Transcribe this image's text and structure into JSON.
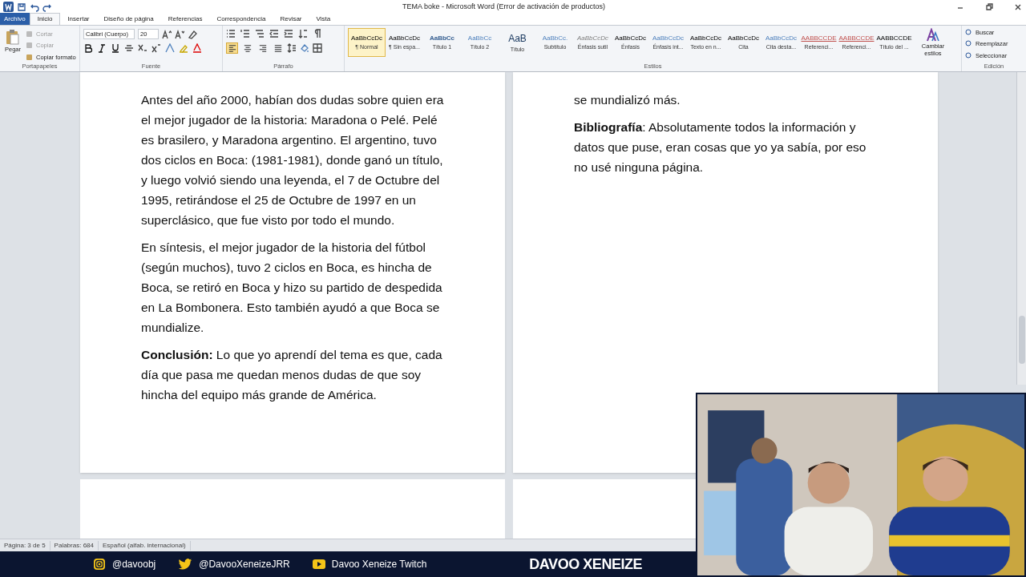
{
  "window": {
    "title": "TEMA boke  -  Microsoft Word (Error de activación de productos)"
  },
  "tabs": [
    {
      "label": "Archivo",
      "kind": "file",
      "selected": false
    },
    {
      "label": "Inicio",
      "kind": "tab",
      "selected": true
    },
    {
      "label": "Insertar",
      "kind": "tab",
      "selected": false
    },
    {
      "label": "Diseño de página",
      "kind": "tab",
      "selected": false
    },
    {
      "label": "Referencias",
      "kind": "tab",
      "selected": false
    },
    {
      "label": "Correspondencia",
      "kind": "tab",
      "selected": false
    },
    {
      "label": "Revisar",
      "kind": "tab",
      "selected": false
    },
    {
      "label": "Vista",
      "kind": "tab",
      "selected": false
    }
  ],
  "clipboard": {
    "label": "Portapapeles",
    "paste": "Pegar",
    "items": [
      {
        "label": "Cortar",
        "disabled": true
      },
      {
        "label": "Copiar",
        "disabled": true
      },
      {
        "label": "Copiar formato",
        "disabled": false
      }
    ]
  },
  "font": {
    "label": "Fuente",
    "name": "Calibri (Cuerpo)",
    "size": "20"
  },
  "paragraph": {
    "label": "Párrafo",
    "alignments": [
      {
        "kind": "left",
        "selected": true
      },
      {
        "kind": "center",
        "selected": false
      },
      {
        "kind": "right",
        "selected": false
      },
      {
        "kind": "justify",
        "selected": false
      }
    ]
  },
  "styles": {
    "label": "Estilos",
    "items": [
      {
        "preview": "AaBbCcDc",
        "label": "¶ Normal",
        "kind": "plain",
        "selected": true
      },
      {
        "preview": "AaBbCcDc",
        "label": "¶ Sin espa...",
        "kind": "plain",
        "selected": false
      },
      {
        "preview": "AaBbCc",
        "label": "Título 1",
        "kind": "heading",
        "selected": false
      },
      {
        "preview": "AaBbCc",
        "label": "Título 2",
        "kind": "accent",
        "selected": false
      },
      {
        "preview": "AaB",
        "label": "Título",
        "kind": "title",
        "selected": false
      },
      {
        "preview": "AaBbCc.",
        "label": "Subtítulo",
        "kind": "accent",
        "selected": false
      },
      {
        "preview": "AaBbCcDc",
        "label": "Énfasis sutil",
        "kind": "subtle",
        "selected": false
      },
      {
        "preview": "AaBbCcDc",
        "label": "Énfasis",
        "kind": "plain",
        "selected": false
      },
      {
        "preview": "AaBbCcDc",
        "label": "Énfasis int...",
        "kind": "accent",
        "selected": false
      },
      {
        "preview": "AaBbCcDc",
        "label": "Texto en n...",
        "kind": "plain",
        "selected": false
      },
      {
        "preview": "AaBbCcDc",
        "label": "Cita",
        "kind": "plain",
        "selected": false
      },
      {
        "preview": "AaBbCcDc",
        "label": "Cita desta...",
        "kind": "accent",
        "selected": false
      },
      {
        "preview": "AABBCCDE",
        "label": "Referenci...",
        "kind": "reference",
        "selected": false
      },
      {
        "preview": "AABBCCDE",
        "label": "Referenci...",
        "kind": "reference",
        "selected": false
      },
      {
        "preview": "AABBCCDE",
        "label": "Título del ...",
        "kind": "plain",
        "selected": false
      }
    ],
    "change": "Cambiar estilos"
  },
  "editing": {
    "label": "Edición",
    "items": [
      "Buscar",
      "Reemplazar",
      "Seleccionar"
    ]
  },
  "pages": [
    {
      "paragraphs": [
        "Antes del año 2000, habían dos dudas sobre quien era el mejor jugador de la historia: Maradona o Pelé. Pelé es brasilero, y Maradona argentino. El argentino, tuvo dos ciclos en Boca: (1981-1981), donde ganó un título, y luego volvió siendo una leyenda, el 7 de Octubre del 1995, retirándose el 25 de Octubre de 1997 en un superclásico, que fue visto por todo el mundo.",
        "En síntesis, el mejor jugador de la historia del fútbol (según muchos), tuvo 2 ciclos en Boca, es hincha de Boca, se retiró en Boca y hizo su partido de despedida en La Bombonera. Esto también ayudó a que Boca se mundialize.",
        "**Conclusión:** Lo que yo aprendí del tema es que, cada día que pasa me quedan menos dudas de que soy hincha del equipo más grande de América."
      ]
    },
    {
      "paragraphs": [
        "se mundializó más.",
        "**Bibliografía**: Absolutamente todos la información y datos que puse, eran cosas que yo ya sabía, por eso no usé ninguna página."
      ]
    }
  ],
  "status_bar": [
    "Página: 3 de 5",
    "Palabras: 684",
    "Español (alfab. internacional)"
  ],
  "overlay": {
    "socials": [
      {
        "kind": "instagram",
        "label": "@davoobj"
      },
      {
        "kind": "twitter",
        "label": "@DavooXeneizeJRR"
      },
      {
        "kind": "youtube",
        "label": "Davoo Xeneize Twitch"
      }
    ],
    "brand": "DAVOO XENEIZE"
  },
  "webcam": {
    "kind": "picture"
  }
}
